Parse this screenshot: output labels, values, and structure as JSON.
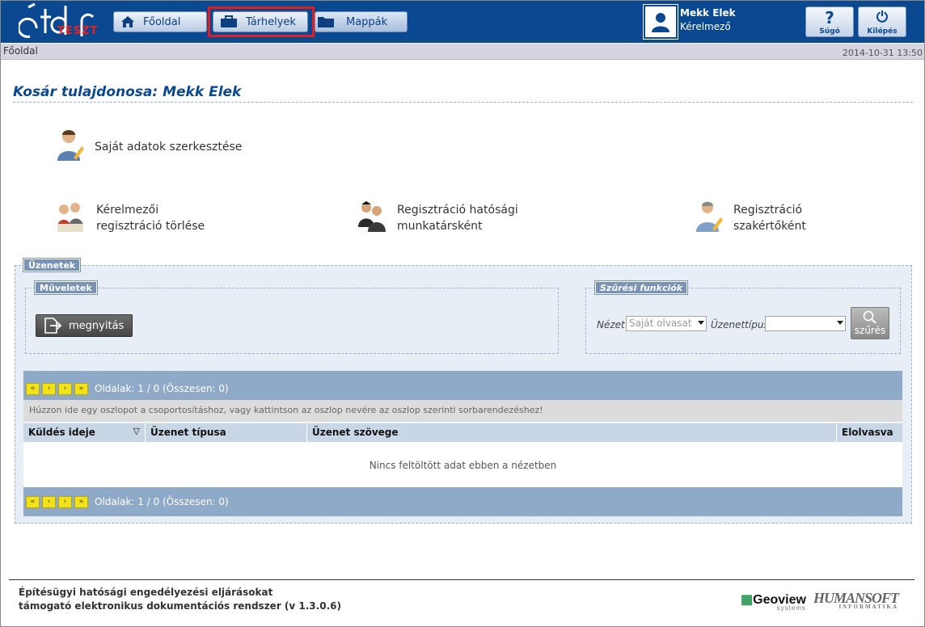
{
  "app": {
    "logo_text": "TESZT"
  },
  "nav": {
    "home_label": "Főoldal",
    "storage_label": "Tárhelyek",
    "folders_label": "Mappák"
  },
  "user": {
    "name": "Mekk Elek",
    "role": "Kérelmező"
  },
  "toolbar": {
    "help_label": "Súgó",
    "exit_label": "Kilépés",
    "help_glyph": "?",
    "exit_glyph": "⏻"
  },
  "breadcrumb": {
    "current": "Főoldal",
    "datetime": "2014-10-31 13:50"
  },
  "page": {
    "title": "Kosár tulajdonosa: Mekk Elek"
  },
  "actions": {
    "edit_profile": "Saját adatok szerkesztése",
    "delete_registration_l1": "Kérelmezői",
    "delete_registration_l2": "regisztráció törlése",
    "register_official_l1": "Regisztráció hatósági",
    "register_official_l2": "munkatársként",
    "register_expert_l1": "Regisztráció",
    "register_expert_l2": "szakértőként"
  },
  "messages": {
    "legend": "Üzenetek",
    "operations_legend": "Műveletek",
    "open_button": "megnyitás",
    "filter_legend": "Szűrési funkciók",
    "view_label": "Nézet",
    "view_value": "Saját olvasat",
    "type_label": "Üzenettípus",
    "type_value": "",
    "search_button": "szűrés",
    "pager_text": "Oldalak: 1 / 0 (Összesen: 0)",
    "group_hint": "Húzzon ide egy oszlopot a csoportosításhoz, vagy kattintson az oszlop nevére az oszlop szerinti sorbarendezéshez!",
    "columns": [
      "Küldés ideje",
      "Üzenet típusa",
      "Üzenet szövege",
      "Elolvasva"
    ],
    "sort_glyph": "▽",
    "empty_text": "Nincs feltöltött adat ebben a nézetben",
    "pager_buttons": [
      "«",
      "‹",
      "›",
      "»"
    ]
  },
  "footer": {
    "line1": "Építésügyi hatósági engedélyezési eljárásokat",
    "line2": "támogató elektronikus dokumentációs rendszer (v 1.3.0.6)",
    "geoview": "Geoview",
    "geoview_sub": "systems",
    "humansoft": "HUMANSOFT",
    "humansoft_sub": "INFORMATIKA"
  },
  "colors": {
    "topbar": "#0a4891",
    "highlight": "#e11d24",
    "pager": "#8fa9c8",
    "title": "#0a4891"
  }
}
